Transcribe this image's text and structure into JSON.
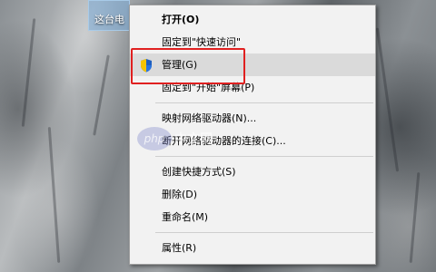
{
  "desktop": {
    "icon_label": "这台电"
  },
  "context_menu": {
    "groups": [
      [
        {
          "label": "打开(O)",
          "bold": true
        },
        {
          "label": "固定到\"快速访问\""
        },
        {
          "label": "管理(G)",
          "icon": "shield-icon",
          "highlighted": true
        },
        {
          "label": "固定到\"开始\"屏幕(P)"
        }
      ],
      [
        {
          "label": "映射网络驱动器(N)..."
        },
        {
          "label": "断开网络驱动器的连接(C)..."
        }
      ],
      [
        {
          "label": "创建快捷方式(S)"
        },
        {
          "label": "删除(D)"
        },
        {
          "label": "重命名(M)"
        }
      ],
      [
        {
          "label": "属性(R)"
        }
      ]
    ]
  },
  "watermark": {
    "brand": "php",
    "site": "中文网"
  },
  "colors": {
    "highlight_border": "#e02020",
    "menu_background": "#f2f2f2",
    "hover_background": "#dadada"
  }
}
